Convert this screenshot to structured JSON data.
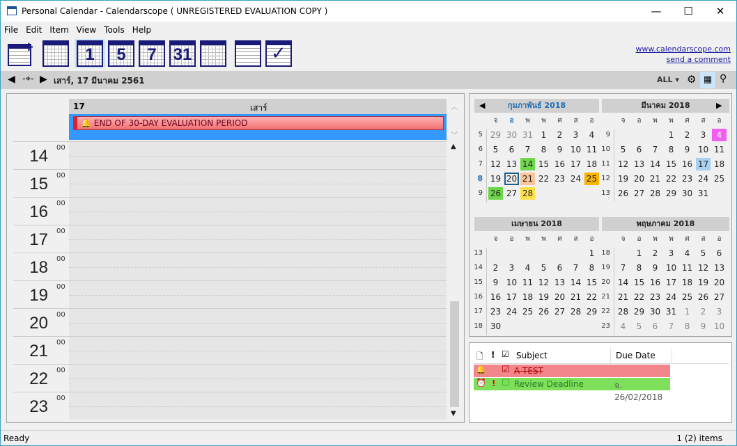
{
  "window": {
    "title": "Personal Calendar - Calendarscope ( UNREGISTERED EVALUATION COPY )",
    "minimize": "—",
    "maximize": "☐",
    "close": "✕"
  },
  "menu": [
    {
      "label": "File"
    },
    {
      "label": "Edit"
    },
    {
      "label": "Item"
    },
    {
      "label": "View"
    },
    {
      "label": "Tools"
    },
    {
      "label": "Help"
    }
  ],
  "toolbar": {
    "day_num": "1",
    "workweek_num": "5",
    "week_num": "7",
    "month_num": "31"
  },
  "links": {
    "website": "www.calendarscope.com",
    "comment": "send a comment"
  },
  "nav": {
    "date": "เสาร์, 17 มีนาคม 2561",
    "filter": "ALL ▾"
  },
  "day_view": {
    "day_number": "17",
    "day_name": "เสาร์",
    "event": "END OF 30-DAY EVALUATION PERIOD",
    "hours": [
      "14",
      "15",
      "16",
      "17",
      "18",
      "19",
      "20",
      "21",
      "22",
      "23"
    ],
    "minutes": "00"
  },
  "day_names": [
    "จ",
    "อ",
    "พ",
    "พ",
    "ศ",
    "ส",
    "อ"
  ],
  "months": [
    {
      "title": "กุมภาพันธ์ 2018",
      "current": true,
      "weeks": [
        [
          5,
          [
            29,
            30,
            31,
            1,
            2,
            3,
            4
          ]
        ],
        [
          6,
          [
            5,
            6,
            7,
            8,
            9,
            10,
            11
          ]
        ],
        [
          7,
          [
            12,
            13,
            14,
            15,
            16,
            17,
            18
          ]
        ],
        [
          8,
          [
            19,
            20,
            21,
            22,
            23,
            24,
            25
          ]
        ],
        [
          9,
          [
            26,
            27,
            28,
            null,
            null,
            null,
            null
          ]
        ]
      ],
      "grey": [
        [
          0,
          0
        ],
        [
          0,
          1
        ],
        [
          0,
          2
        ]
      ],
      "marks": {
        "2,2": "#6dd64a",
        "3,1": "box",
        "3,2": "#fcc59a",
        "3,6": "#f7b500",
        "4,0": "#6dd64a",
        "4,2": "#ffe14d"
      }
    },
    {
      "title": "มีนาคม 2018",
      "weeks": [
        [
          9,
          [
            null,
            null,
            null,
            1,
            2,
            3,
            4
          ]
        ],
        [
          10,
          [
            5,
            6,
            7,
            8,
            9,
            10,
            11
          ]
        ],
        [
          11,
          [
            12,
            13,
            14,
            15,
            16,
            17,
            18
          ]
        ],
        [
          12,
          [
            19,
            20,
            21,
            22,
            23,
            24,
            25
          ]
        ],
        [
          13,
          [
            26,
            27,
            28,
            29,
            30,
            31,
            null
          ]
        ]
      ],
      "grey": [],
      "marks": {
        "0,6": "#f060f0",
        "2,5": "#a8d0f0"
      }
    },
    {
      "title": "เมษายน 2018",
      "weeks": [
        [
          13,
          [
            null,
            null,
            null,
            null,
            null,
            null,
            1
          ]
        ],
        [
          14,
          [
            2,
            3,
            4,
            5,
            6,
            7,
            8
          ]
        ],
        [
          15,
          [
            9,
            10,
            11,
            12,
            13,
            14,
            15
          ]
        ],
        [
          16,
          [
            16,
            17,
            18,
            19,
            20,
            21,
            22
          ]
        ],
        [
          17,
          [
            23,
            24,
            25,
            26,
            27,
            28,
            29
          ]
        ],
        [
          18,
          [
            30,
            null,
            null,
            null,
            null,
            null,
            null
          ]
        ]
      ],
      "grey": [],
      "marks": {}
    },
    {
      "title": "พฤษภาคม 2018",
      "weeks": [
        [
          18,
          [
            null,
            1,
            2,
            3,
            4,
            5,
            6
          ]
        ],
        [
          19,
          [
            7,
            8,
            9,
            10,
            11,
            12,
            13
          ]
        ],
        [
          20,
          [
            14,
            15,
            16,
            17,
            18,
            19,
            20
          ]
        ],
        [
          21,
          [
            21,
            22,
            23,
            24,
            25,
            26,
            27
          ]
        ],
        [
          22,
          [
            28,
            29,
            30,
            31,
            1,
            2,
            3
          ]
        ],
        [
          23,
          [
            4,
            5,
            6,
            7,
            8,
            9,
            10
          ]
        ]
      ],
      "grey": [
        [
          4,
          4
        ],
        [
          4,
          5
        ],
        [
          4,
          6
        ],
        [
          5,
          0
        ],
        [
          5,
          1
        ],
        [
          5,
          2
        ],
        [
          5,
          3
        ],
        [
          5,
          4
        ],
        [
          5,
          5
        ],
        [
          5,
          6
        ]
      ],
      "marks": {}
    }
  ],
  "tasks": {
    "columns": [
      "Subject",
      "Due Date"
    ],
    "rows": [
      {
        "subject": "A TEST",
        "due": "",
        "done": true,
        "priority": "",
        "color": "#f2868c"
      },
      {
        "subject": "Review Deadline",
        "due": "จ. 26/02/2018",
        "done": false,
        "priority": "!",
        "color": "#7ee05a"
      }
    ]
  },
  "status": {
    "left": "Ready",
    "right": "1 (2) items"
  }
}
